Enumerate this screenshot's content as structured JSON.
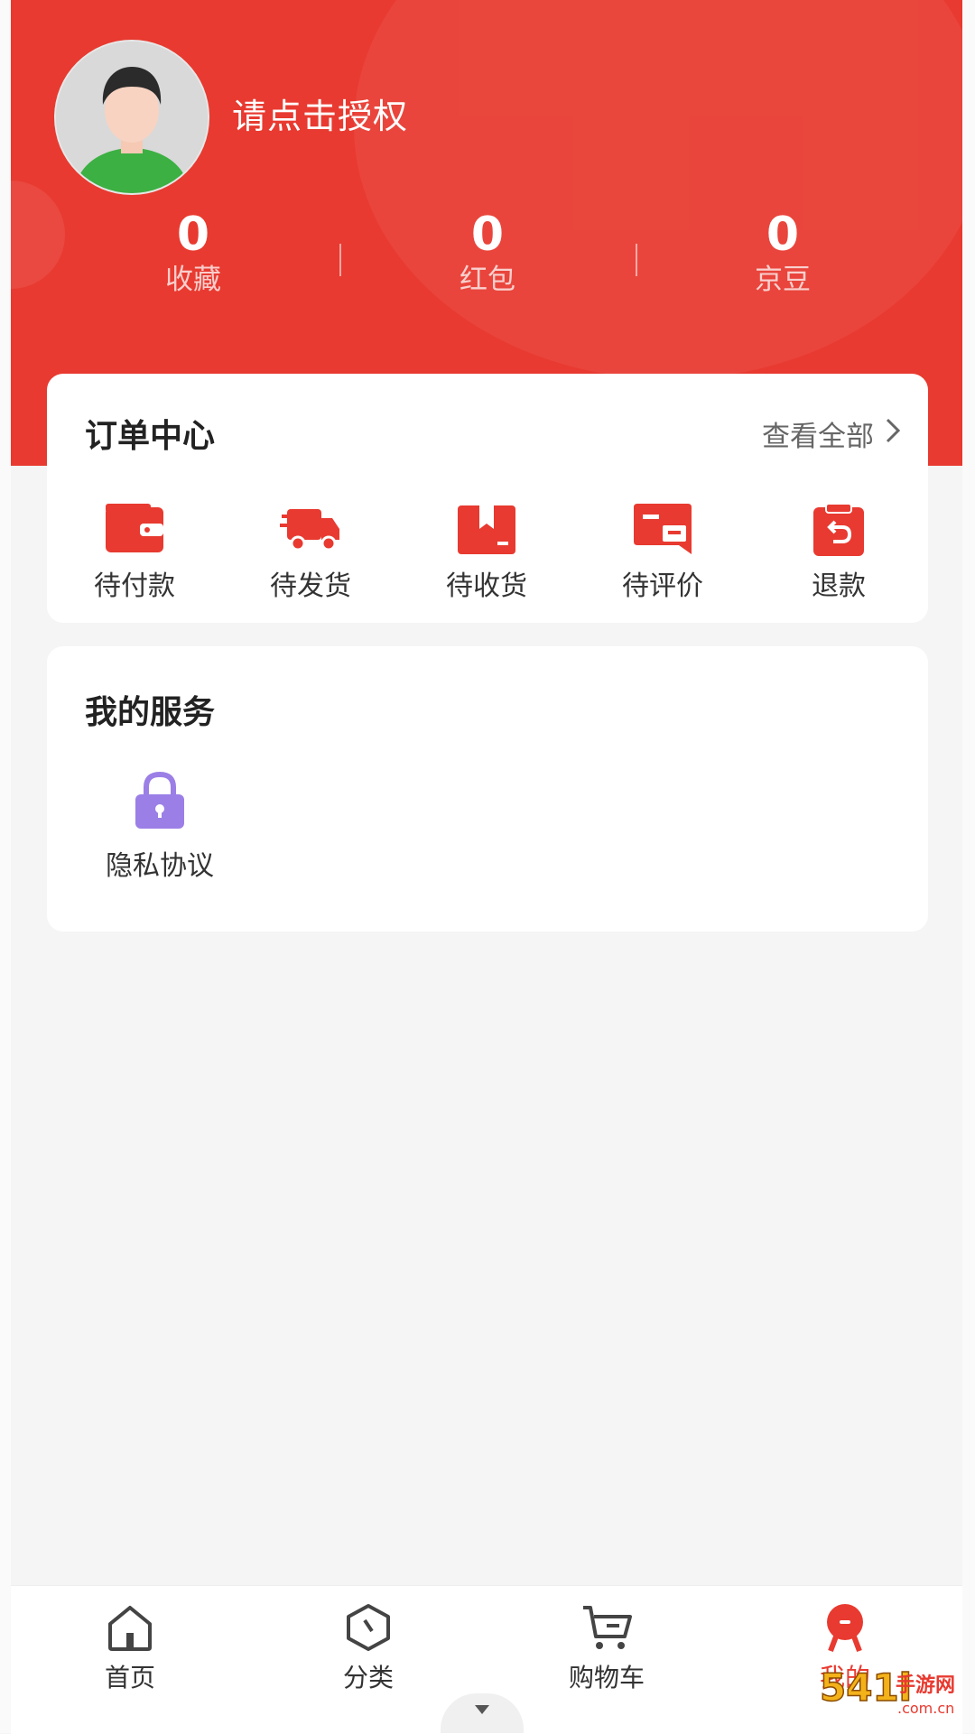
{
  "header": {
    "auth_text": "请点击授权",
    "stats": [
      {
        "value": "0",
        "label": "收藏"
      },
      {
        "value": "0",
        "label": "红包"
      },
      {
        "value": "0",
        "label": "京豆"
      }
    ]
  },
  "orders": {
    "title": "订单中心",
    "view_all": "查看全部",
    "items": [
      {
        "label": "待付款",
        "icon": "wallet-icon"
      },
      {
        "label": "待发货",
        "icon": "truck-icon"
      },
      {
        "label": "待收货",
        "icon": "box-icon"
      },
      {
        "label": "待评价",
        "icon": "comment-icon"
      },
      {
        "label": "退款",
        "icon": "refund-icon"
      }
    ]
  },
  "services": {
    "title": "我的服务",
    "items": [
      {
        "label": "隐私协议",
        "icon": "lock-icon"
      }
    ]
  },
  "tabbar": {
    "items": [
      {
        "label": "首页",
        "icon": "home-icon"
      },
      {
        "label": "分类",
        "icon": "category-icon"
      },
      {
        "label": "购物车",
        "icon": "cart-icon"
      },
      {
        "label": "我的",
        "icon": "profile-icon",
        "active": true
      }
    ]
  },
  "watermark": {
    "text": "541l手游网",
    "sub": ".com.cn"
  },
  "colors": {
    "primary": "#e83a30",
    "page_bg": "#f5f5f5",
    "lock": "#9b7fe6"
  }
}
